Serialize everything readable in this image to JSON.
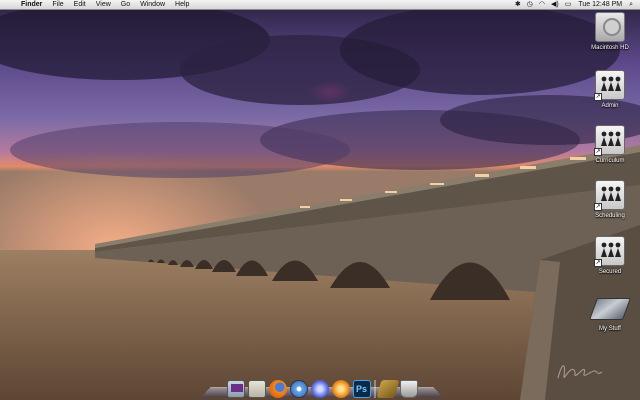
{
  "menubar": {
    "app_name": "Finder",
    "items": [
      "File",
      "Edit",
      "View",
      "Go",
      "Window",
      "Help"
    ],
    "clock": "Tue 12:48 PM"
  },
  "desktop": {
    "icons": [
      {
        "label": "Macintosh HD",
        "icon": "hard-drive-icon"
      },
      {
        "label": "Admin",
        "icon": "network-drive-icon"
      },
      {
        "label": "Curriculum",
        "icon": "network-drive-icon"
      },
      {
        "label": "Scheduling",
        "icon": "network-drive-icon"
      },
      {
        "label": "Secured",
        "icon": "network-drive-icon"
      },
      {
        "label": "My Stuff",
        "icon": "folder-icon"
      }
    ]
  },
  "dock": {
    "items": [
      "imac-icon",
      "preview-icon",
      "firefox-icon",
      "safari-icon",
      "itunes-icon",
      "cyberduck-icon",
      "photoshop-icon",
      "folder-icon",
      "trash-icon"
    ]
  },
  "colors": {
    "sky_top": "#2a1f3a",
    "sky_purple": "#7a5aa8",
    "sunset": "#e8785a",
    "water": "#8a6a4a",
    "bridge": "#6f6356"
  }
}
